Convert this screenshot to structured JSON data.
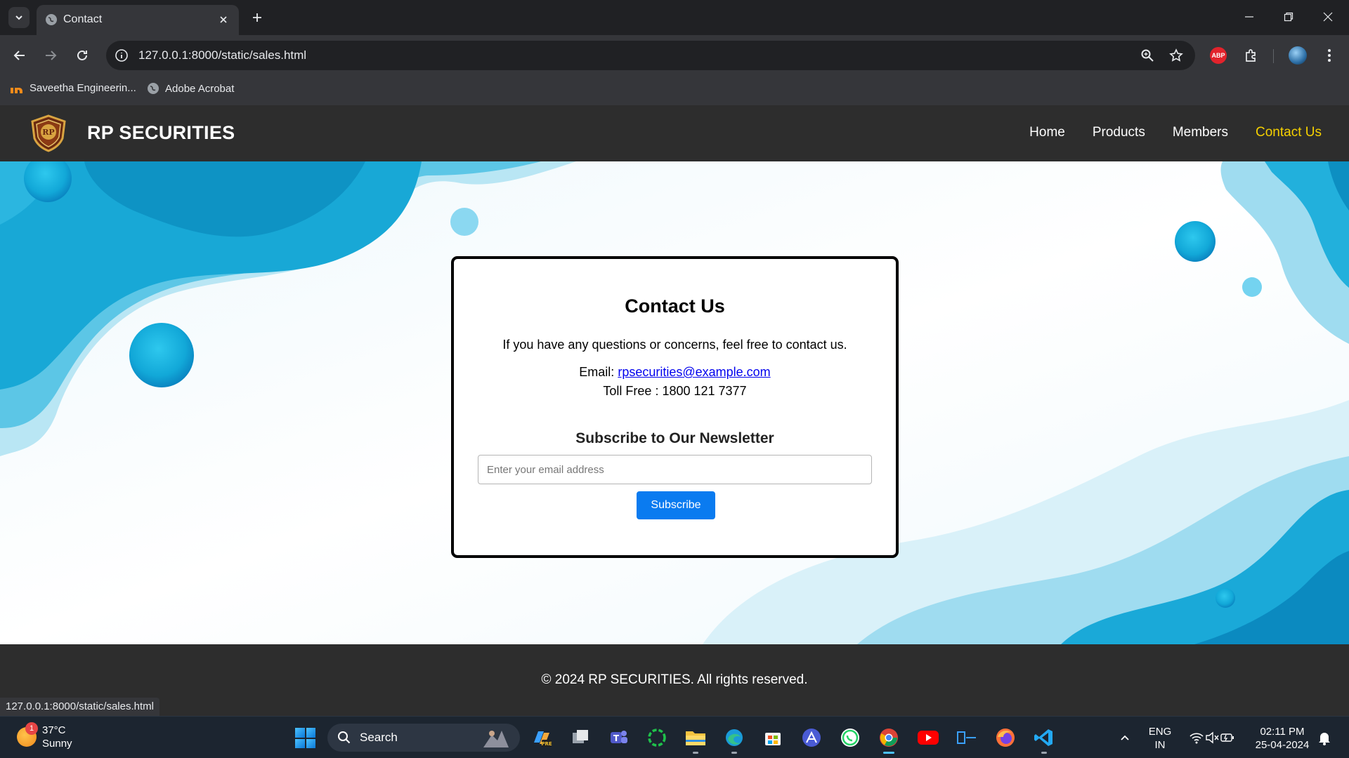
{
  "browser": {
    "tab": {
      "title": "Contact"
    },
    "address_bar": {
      "url": "127.0.0.1:8000/static/sales.html"
    },
    "bookmarks": [
      {
        "label": "Saveetha Engineerin..."
      },
      {
        "label": "Adobe Acrobat"
      }
    ],
    "extension_abp_label": "ABP",
    "status_url": "127.0.0.1:8000/static/sales.html"
  },
  "site": {
    "brand": "RP SECURITIES",
    "logo_text": "RP",
    "nav": [
      {
        "label": "Home"
      },
      {
        "label": "Products"
      },
      {
        "label": "Members"
      },
      {
        "label": "Contact Us",
        "active": true
      }
    ],
    "active_nav_color": "#f5d000",
    "contact": {
      "title": "Contact Us",
      "intro": "If you have any questions or concerns, feel free to contact us.",
      "email_label": "Email:",
      "email": "rpsecurities@example.com",
      "phone": "Toll Free : 1800 121 7377"
    },
    "newsletter": {
      "title": "Subscribe to Our Newsletter",
      "placeholder": "Enter your email address",
      "button_label": "Subscribe",
      "button_color": "#0a7bf0"
    },
    "footer": {
      "text": "© 2024 RP SECURITIES. All rights reserved."
    }
  },
  "taskbar": {
    "weather": {
      "temp": "37°C",
      "condition": "Sunny",
      "badge": "1"
    },
    "search_label": "Search",
    "language": {
      "line1": "ENG",
      "line2": "IN"
    },
    "clock": {
      "time": "02:11 PM",
      "date": "25-04-2024"
    },
    "apps": [
      "copilot-icon",
      "task-view-icon",
      "teams-icon",
      "loader-icon",
      "file-explorer-icon",
      "edge-icon",
      "store-icon",
      "affinity-icon",
      "whatsapp-icon",
      "chrome-icon",
      "youtube-icon",
      "terminal-icon",
      "firefox-icon",
      "vscode-icon"
    ]
  }
}
